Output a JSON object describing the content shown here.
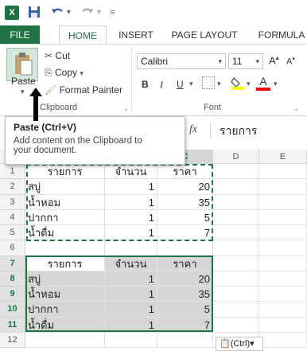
{
  "qat": {
    "logo_text": "X",
    "undo_icon": "undo-icon",
    "redo_icon": "redo-icon"
  },
  "tabs": [
    {
      "label": "FILE"
    },
    {
      "label": "HOME"
    },
    {
      "label": "INSERT"
    },
    {
      "label": "PAGE LAYOUT"
    },
    {
      "label": "FORMULA"
    }
  ],
  "clipboard": {
    "paste_label": "Paste",
    "cut_label": "Cut",
    "copy_label": "Copy",
    "format_painter_label": "Format Painter",
    "group_label": "Clipboard"
  },
  "font": {
    "family": "Calibri",
    "size": "11",
    "bold": "B",
    "italic": "I",
    "underline": "U",
    "grow": "A",
    "shrink": "A",
    "font_color_letter": "A",
    "group_label": "Font",
    "highlight_color": "#ffff00",
    "font_color": "#ff0000"
  },
  "tooltip": {
    "title": "Paste (Ctrl+V)",
    "desc_line1": "Add content on the Clipboard to",
    "desc_line2": "your document."
  },
  "formula_bar": {
    "fx": "fx",
    "value": "รายการ"
  },
  "columns": [
    "C",
    "D",
    "E"
  ],
  "rows": [
    {
      "n": "1",
      "a": "รายการ",
      "b": "จำนวน",
      "c": "ราคา"
    },
    {
      "n": "2",
      "a": "สบู่",
      "b": "1",
      "c": "20"
    },
    {
      "n": "3",
      "a": "น้ำหอม",
      "b": "1",
      "c": "35"
    },
    {
      "n": "4",
      "a": "ปากกา",
      "b": "1",
      "c": "5"
    },
    {
      "n": "5",
      "a": "น้ำดื่ม",
      "b": "1",
      "c": "7"
    },
    {
      "n": "6",
      "a": "",
      "b": "",
      "c": ""
    },
    {
      "n": "7",
      "a": "รายการ",
      "b": "จำนวน",
      "c": "ราคา"
    },
    {
      "n": "8",
      "a": "สบู่",
      "b": "1",
      "c": "20"
    },
    {
      "n": "9",
      "a": "น้ำหอม",
      "b": "1",
      "c": "35"
    },
    {
      "n": "10",
      "a": "ปากกา",
      "b": "1",
      "c": "5"
    },
    {
      "n": "11",
      "a": "น้ำดื่ม",
      "b": "1",
      "c": "7"
    },
    {
      "n": "12",
      "a": "",
      "b": "",
      "c": ""
    }
  ],
  "paste_options": {
    "label": "(Ctrl)",
    "chevron": "▾"
  },
  "accent": "#217346"
}
